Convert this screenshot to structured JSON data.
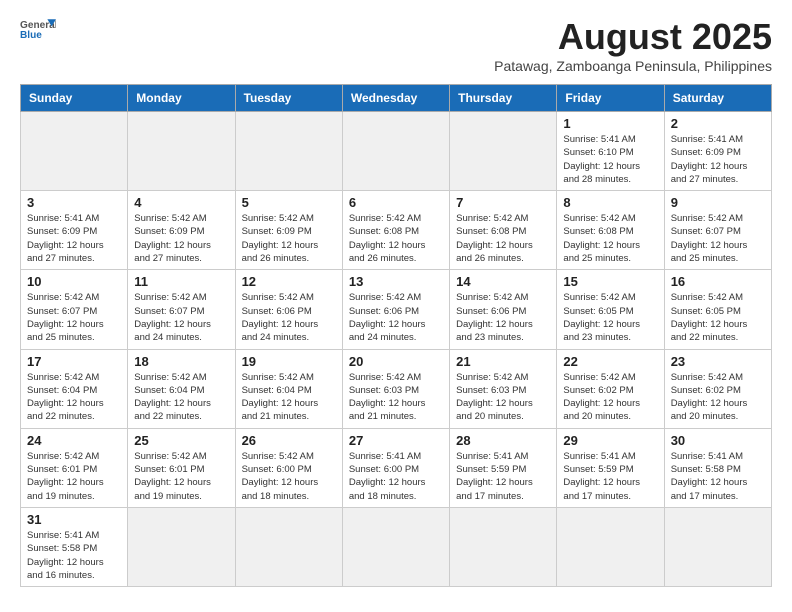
{
  "header": {
    "logo_general": "General",
    "logo_blue": "Blue",
    "month_year": "August 2025",
    "subtitle": "Patawag, Zamboanga Peninsula, Philippines"
  },
  "weekdays": [
    "Sunday",
    "Monday",
    "Tuesday",
    "Wednesday",
    "Thursday",
    "Friday",
    "Saturday"
  ],
  "weeks": [
    [
      {
        "day": "",
        "info": ""
      },
      {
        "day": "",
        "info": ""
      },
      {
        "day": "",
        "info": ""
      },
      {
        "day": "",
        "info": ""
      },
      {
        "day": "",
        "info": ""
      },
      {
        "day": "1",
        "info": "Sunrise: 5:41 AM\nSunset: 6:10 PM\nDaylight: 12 hours and 28 minutes."
      },
      {
        "day": "2",
        "info": "Sunrise: 5:41 AM\nSunset: 6:09 PM\nDaylight: 12 hours and 27 minutes."
      }
    ],
    [
      {
        "day": "3",
        "info": "Sunrise: 5:41 AM\nSunset: 6:09 PM\nDaylight: 12 hours and 27 minutes."
      },
      {
        "day": "4",
        "info": "Sunrise: 5:42 AM\nSunset: 6:09 PM\nDaylight: 12 hours and 27 minutes."
      },
      {
        "day": "5",
        "info": "Sunrise: 5:42 AM\nSunset: 6:09 PM\nDaylight: 12 hours and 26 minutes."
      },
      {
        "day": "6",
        "info": "Sunrise: 5:42 AM\nSunset: 6:08 PM\nDaylight: 12 hours and 26 minutes."
      },
      {
        "day": "7",
        "info": "Sunrise: 5:42 AM\nSunset: 6:08 PM\nDaylight: 12 hours and 26 minutes."
      },
      {
        "day": "8",
        "info": "Sunrise: 5:42 AM\nSunset: 6:08 PM\nDaylight: 12 hours and 25 minutes."
      },
      {
        "day": "9",
        "info": "Sunrise: 5:42 AM\nSunset: 6:07 PM\nDaylight: 12 hours and 25 minutes."
      }
    ],
    [
      {
        "day": "10",
        "info": "Sunrise: 5:42 AM\nSunset: 6:07 PM\nDaylight: 12 hours and 25 minutes."
      },
      {
        "day": "11",
        "info": "Sunrise: 5:42 AM\nSunset: 6:07 PM\nDaylight: 12 hours and 24 minutes."
      },
      {
        "day": "12",
        "info": "Sunrise: 5:42 AM\nSunset: 6:06 PM\nDaylight: 12 hours and 24 minutes."
      },
      {
        "day": "13",
        "info": "Sunrise: 5:42 AM\nSunset: 6:06 PM\nDaylight: 12 hours and 24 minutes."
      },
      {
        "day": "14",
        "info": "Sunrise: 5:42 AM\nSunset: 6:06 PM\nDaylight: 12 hours and 23 minutes."
      },
      {
        "day": "15",
        "info": "Sunrise: 5:42 AM\nSunset: 6:05 PM\nDaylight: 12 hours and 23 minutes."
      },
      {
        "day": "16",
        "info": "Sunrise: 5:42 AM\nSunset: 6:05 PM\nDaylight: 12 hours and 22 minutes."
      }
    ],
    [
      {
        "day": "17",
        "info": "Sunrise: 5:42 AM\nSunset: 6:04 PM\nDaylight: 12 hours and 22 minutes."
      },
      {
        "day": "18",
        "info": "Sunrise: 5:42 AM\nSunset: 6:04 PM\nDaylight: 12 hours and 22 minutes."
      },
      {
        "day": "19",
        "info": "Sunrise: 5:42 AM\nSunset: 6:04 PM\nDaylight: 12 hours and 21 minutes."
      },
      {
        "day": "20",
        "info": "Sunrise: 5:42 AM\nSunset: 6:03 PM\nDaylight: 12 hours and 21 minutes."
      },
      {
        "day": "21",
        "info": "Sunrise: 5:42 AM\nSunset: 6:03 PM\nDaylight: 12 hours and 20 minutes."
      },
      {
        "day": "22",
        "info": "Sunrise: 5:42 AM\nSunset: 6:02 PM\nDaylight: 12 hours and 20 minutes."
      },
      {
        "day": "23",
        "info": "Sunrise: 5:42 AM\nSunset: 6:02 PM\nDaylight: 12 hours and 20 minutes."
      }
    ],
    [
      {
        "day": "24",
        "info": "Sunrise: 5:42 AM\nSunset: 6:01 PM\nDaylight: 12 hours and 19 minutes."
      },
      {
        "day": "25",
        "info": "Sunrise: 5:42 AM\nSunset: 6:01 PM\nDaylight: 12 hours and 19 minutes."
      },
      {
        "day": "26",
        "info": "Sunrise: 5:42 AM\nSunset: 6:00 PM\nDaylight: 12 hours and 18 minutes."
      },
      {
        "day": "27",
        "info": "Sunrise: 5:41 AM\nSunset: 6:00 PM\nDaylight: 12 hours and 18 minutes."
      },
      {
        "day": "28",
        "info": "Sunrise: 5:41 AM\nSunset: 5:59 PM\nDaylight: 12 hours and 17 minutes."
      },
      {
        "day": "29",
        "info": "Sunrise: 5:41 AM\nSunset: 5:59 PM\nDaylight: 12 hours and 17 minutes."
      },
      {
        "day": "30",
        "info": "Sunrise: 5:41 AM\nSunset: 5:58 PM\nDaylight: 12 hours and 17 minutes."
      }
    ],
    [
      {
        "day": "31",
        "info": "Sunrise: 5:41 AM\nSunset: 5:58 PM\nDaylight: 12 hours and 16 minutes."
      },
      {
        "day": "",
        "info": ""
      },
      {
        "day": "",
        "info": ""
      },
      {
        "day": "",
        "info": ""
      },
      {
        "day": "",
        "info": ""
      },
      {
        "day": "",
        "info": ""
      },
      {
        "day": "",
        "info": ""
      }
    ]
  ]
}
